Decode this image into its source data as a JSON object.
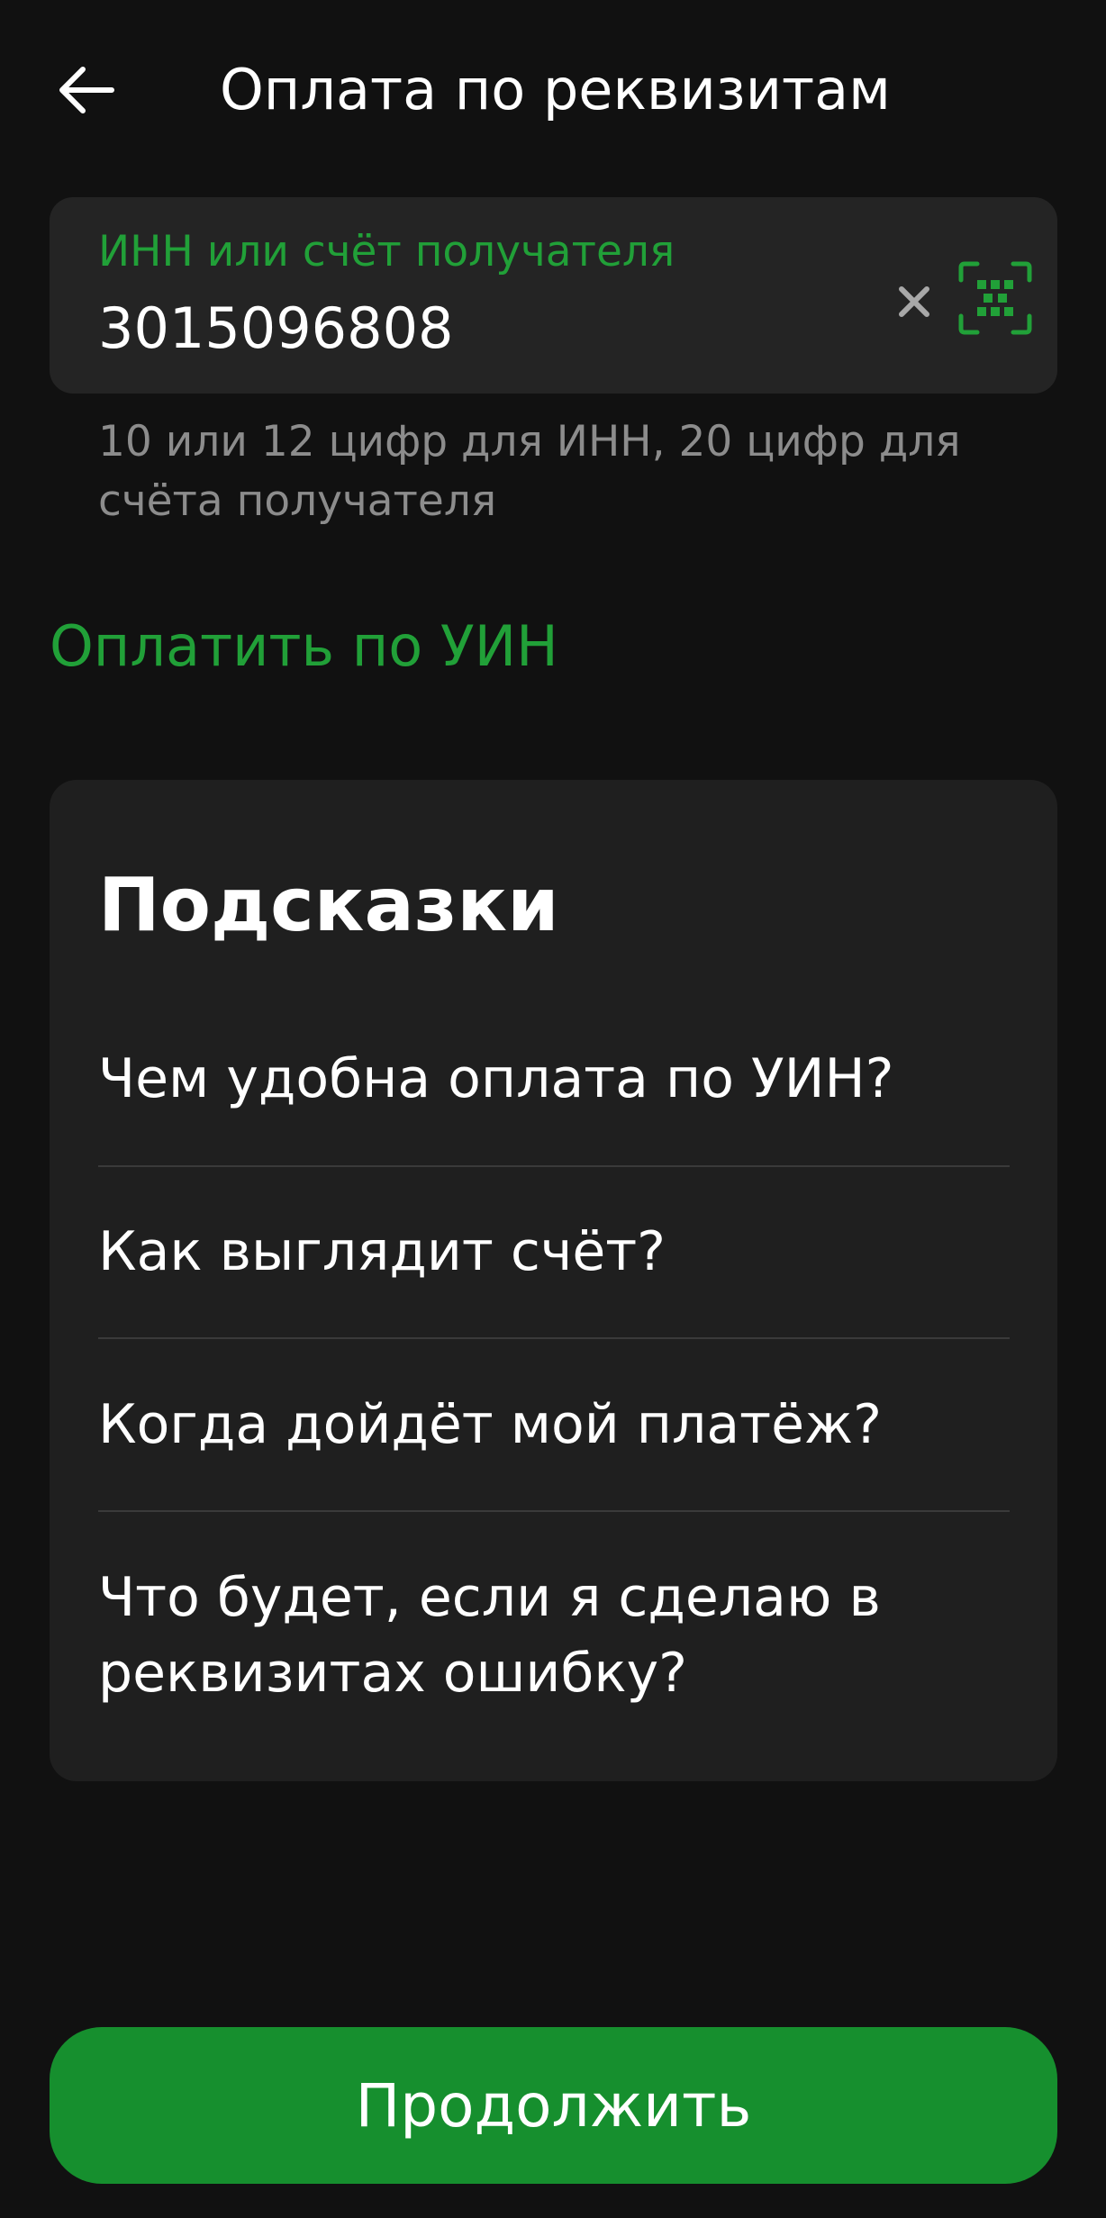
{
  "header": {
    "title": "Оплата по реквизитам",
    "back_icon": "arrow-left-icon"
  },
  "recipient_field": {
    "label": "ИНН или счёт получателя",
    "value": "3015096808",
    "hint": "10 или 12 цифр для ИНН, 20 цифр для счёта получателя",
    "clear_icon": "close-icon",
    "scan_icon": "qr-scan-icon"
  },
  "uin_link": "Оплатить по УИН",
  "tips": {
    "title": "Подсказки",
    "items": [
      {
        "label": "Чем удобна оплата по УИН?"
      },
      {
        "label": "Как выглядит счёт?"
      },
      {
        "label": "Когда дойдёт мой платёж?"
      },
      {
        "label": "Что будет, если я сделаю в реквизитах ошибку?"
      }
    ]
  },
  "continue_button": {
    "label": "Продолжить"
  },
  "colors": {
    "accent": "#21a038",
    "button": "#168f2e",
    "background": "#111111",
    "card": "#1f1f1f",
    "field": "#242424",
    "hint_text": "#8c8c8c"
  }
}
